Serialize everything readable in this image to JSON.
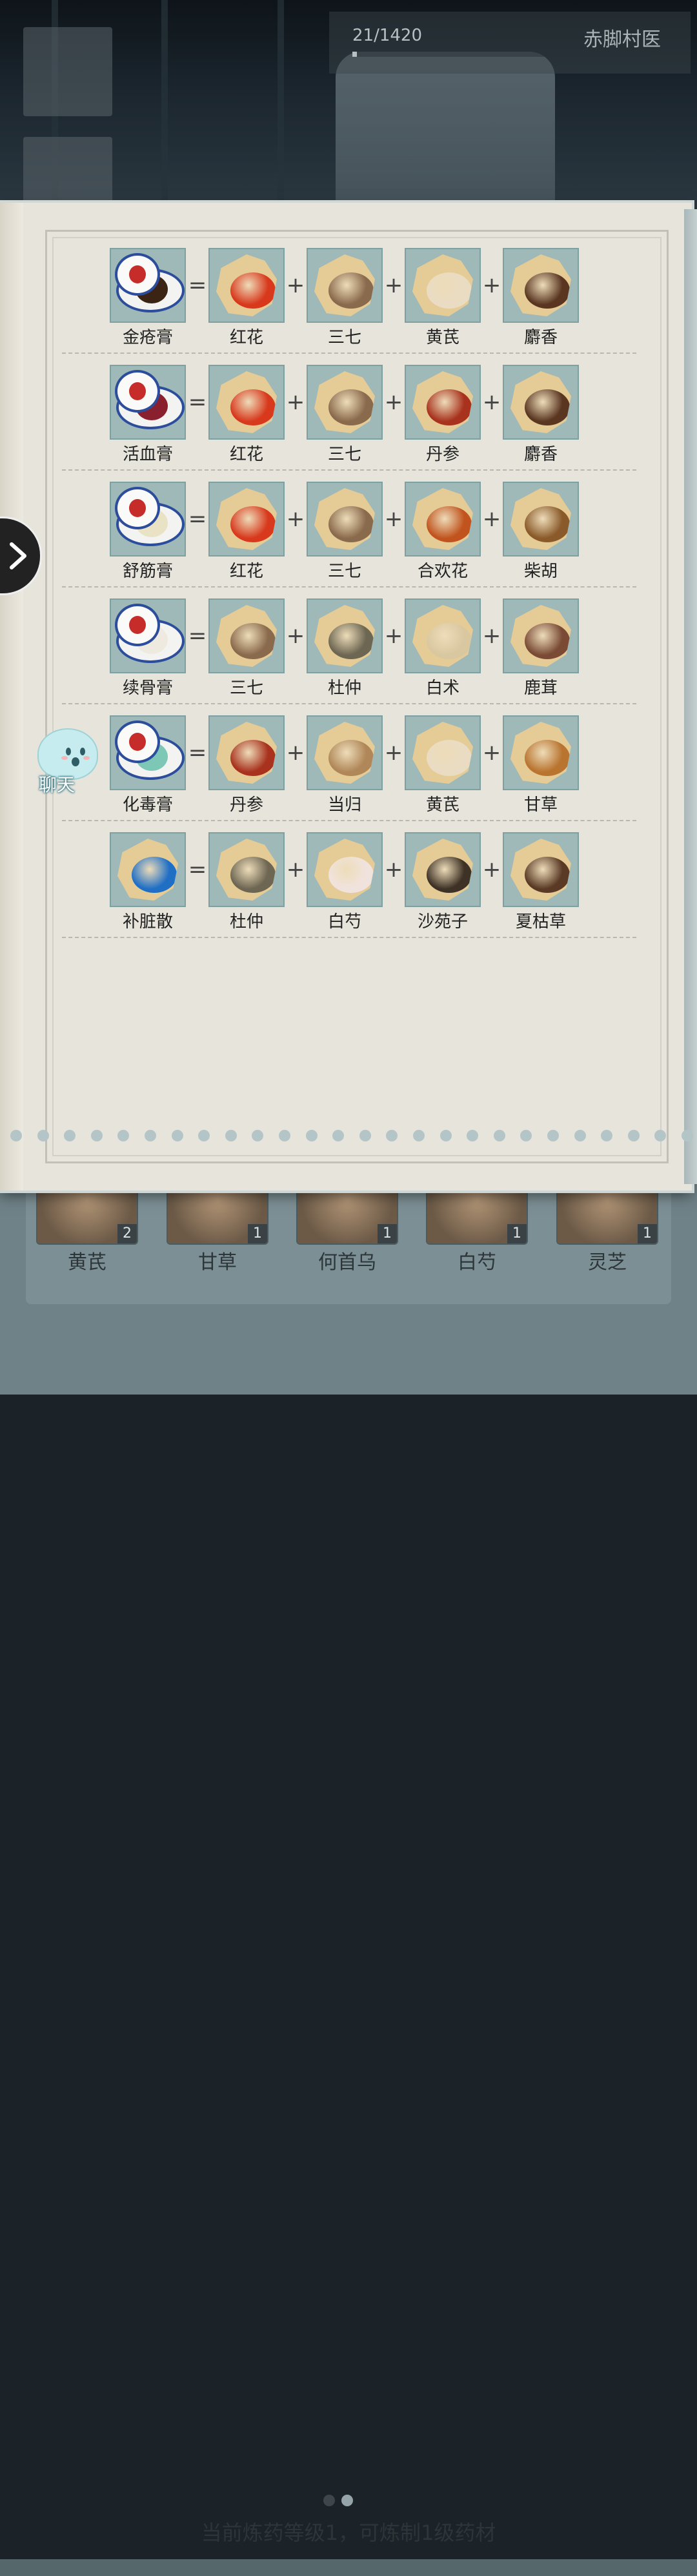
{
  "header": {
    "exp_text": "21/1420",
    "exp_progress": 0.015,
    "player_title": "赤脚村医"
  },
  "recipes": [
    {
      "product": {
        "name": "金疮膏",
        "icon": "ointment-jar-dark"
      },
      "ingredients": [
        {
          "name": "红花",
          "icon": "safflower"
        },
        {
          "name": "三七",
          "icon": "notoginseng"
        },
        {
          "name": "黄芪",
          "icon": "astragalus"
        },
        {
          "name": "麝香",
          "icon": "musk"
        }
      ]
    },
    {
      "product": {
        "name": "活血膏",
        "icon": "ointment-jar-red"
      },
      "ingredients": [
        {
          "name": "红花",
          "icon": "safflower"
        },
        {
          "name": "三七",
          "icon": "notoginseng"
        },
        {
          "name": "丹参",
          "icon": "salvia-root"
        },
        {
          "name": "麝香",
          "icon": "musk"
        }
      ]
    },
    {
      "product": {
        "name": "舒筋膏",
        "icon": "ointment-jar-cream"
      },
      "ingredients": [
        {
          "name": "红花",
          "icon": "safflower"
        },
        {
          "name": "三七",
          "icon": "notoginseng"
        },
        {
          "name": "合欢花",
          "icon": "albizia-flower"
        },
        {
          "name": "柴胡",
          "icon": "bupleurum"
        }
      ]
    },
    {
      "product": {
        "name": "续骨膏",
        "icon": "ointment-jar-white"
      },
      "ingredients": [
        {
          "name": "三七",
          "icon": "notoginseng"
        },
        {
          "name": "杜仲",
          "icon": "eucommia-bark"
        },
        {
          "name": "白术",
          "icon": "atractylodes"
        },
        {
          "name": "鹿茸",
          "icon": "deer-antler"
        }
      ]
    },
    {
      "product": {
        "name": "化毒膏",
        "icon": "ointment-jar-green"
      },
      "ingredients": [
        {
          "name": "丹参",
          "icon": "salvia-root"
        },
        {
          "name": "当归",
          "icon": "angelica"
        },
        {
          "name": "黄芪",
          "icon": "astragalus"
        },
        {
          "name": "甘草",
          "icon": "licorice"
        }
      ]
    },
    {
      "product": {
        "name": "补脏散",
        "icon": "blue-powder"
      },
      "ingredients": [
        {
          "name": "杜仲",
          "icon": "eucommia-bark"
        },
        {
          "name": "白芍",
          "icon": "white-peony"
        },
        {
          "name": "沙苑子",
          "icon": "astragalus-seed"
        },
        {
          "name": "夏枯草",
          "icon": "prunella"
        }
      ]
    }
  ],
  "operators": {
    "equals": "=",
    "plus": "+"
  },
  "chat": {
    "label": "聊天"
  },
  "inventory": {
    "items": [
      {
        "name": "黄芪",
        "count": "2"
      },
      {
        "name": "甘草",
        "count": "1"
      },
      {
        "name": "何首乌",
        "count": "1"
      },
      {
        "name": "白芍",
        "count": "1"
      },
      {
        "name": "灵芝",
        "count": "1"
      }
    ],
    "page_count": 2,
    "current_page": 1
  },
  "status": "当前炼药等级1，可炼制1级药材",
  "colors": {
    "tile_bg": "#9eb9b8",
    "page_bg": "#e6e4db",
    "jar_rim": "#2c4c9c",
    "seal_red": "#c62c2a"
  }
}
